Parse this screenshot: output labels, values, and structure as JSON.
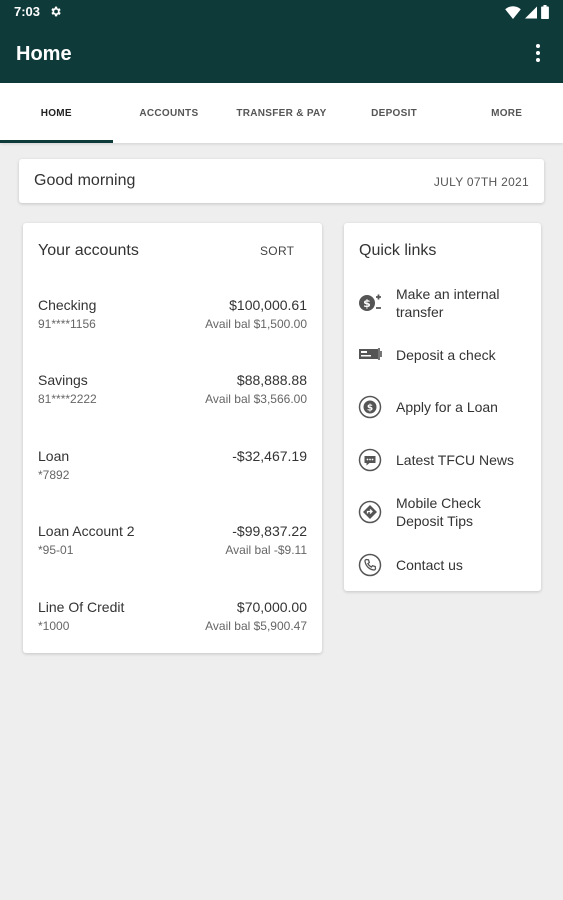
{
  "status_bar": {
    "time": "7:03"
  },
  "app_bar": {
    "title": "Home"
  },
  "tabs": [
    {
      "label": "HOME"
    },
    {
      "label": "ACCOUNTS"
    },
    {
      "label": "TRANSFER & PAY"
    },
    {
      "label": "DEPOSIT"
    },
    {
      "label": "MORE"
    }
  ],
  "greeting": {
    "text": "Good morning",
    "date": "JULY 07TH 2021"
  },
  "accounts": {
    "title": "Your accounts",
    "sort_label": "SORT",
    "items": [
      {
        "name": "Checking",
        "number": "91****1156",
        "balance": "$100,000.61",
        "avail": "Avail bal $1,500.00"
      },
      {
        "name": "Savings",
        "number": "81****2222",
        "balance": "$88,888.88",
        "avail": "Avail bal $3,566.00"
      },
      {
        "name": "Loan",
        "number": "*7892",
        "balance": "-$32,467.19",
        "avail": ""
      },
      {
        "name": "Loan Account 2",
        "number": "*95-01",
        "balance": "-$99,837.22",
        "avail": "Avail bal -$9.11"
      },
      {
        "name": "Line Of Credit",
        "number": "*1000",
        "balance": "$70,000.00",
        "avail": "Avail bal $5,900.47"
      }
    ]
  },
  "quick_links": {
    "title": "Quick links",
    "items": [
      {
        "label": "Make an internal transfer",
        "icon": "transfer-icon"
      },
      {
        "label": "Deposit a check",
        "icon": "check-icon"
      },
      {
        "label": "Apply for a Loan",
        "icon": "loan-icon"
      },
      {
        "label": "Latest TFCU News",
        "icon": "news-icon"
      },
      {
        "label": "Mobile Check Deposit Tips",
        "icon": "tips-icon"
      },
      {
        "label": "Contact us",
        "icon": "phone-icon"
      }
    ]
  },
  "colors": {
    "primary": "#0f3a3a",
    "background": "#eeeeee"
  }
}
